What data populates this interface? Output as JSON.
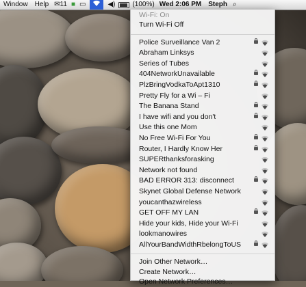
{
  "menubar": {
    "window_label": "Window",
    "help_label": "Help",
    "notif_count": "11",
    "battery_text": "(100%)",
    "clock": "Wed 2:06 PM",
    "user": "Steph"
  },
  "wifi_menu": {
    "status": "Wi-Fi: On",
    "toggle_label": "Turn Wi-Fi Off",
    "networks": [
      {
        "name": "Police Surveillance Van 2",
        "locked": true
      },
      {
        "name": "Abraham Linksys",
        "locked": false
      },
      {
        "name": "Series of Tubes",
        "locked": false
      },
      {
        "name": "404NetworkUnavailable",
        "locked": true
      },
      {
        "name": "PlzBringVodkaToApt1310",
        "locked": true
      },
      {
        "name": "Pretty Fly for a Wi – Fi",
        "locked": false
      },
      {
        "name": "The Banana Stand",
        "locked": true
      },
      {
        "name": "I have wifi and you don't",
        "locked": true
      },
      {
        "name": "Use this one Mom",
        "locked": false
      },
      {
        "name": "No Free Wi-Fi For You",
        "locked": true
      },
      {
        "name": "Router, I Hardly Know Her",
        "locked": true
      },
      {
        "name": "SUPERthanksforasking",
        "locked": false
      },
      {
        "name": "Network not found",
        "locked": false
      },
      {
        "name": "BAD ERROR 313: disconnect",
        "locked": true
      },
      {
        "name": "Skynet Global Defense Network",
        "locked": false
      },
      {
        "name": "youcanthazwireless",
        "locked": false
      },
      {
        "name": "GET OFF MY LAN",
        "locked": true
      },
      {
        "name": "Hide your kids, Hide your Wi-Fi",
        "locked": false
      },
      {
        "name": "lookmanowires",
        "locked": false
      },
      {
        "name": "AllYourBandWidthRbelongToUS",
        "locked": true
      }
    ],
    "actions": {
      "join_other": "Join Other Network…",
      "create": "Create Network…",
      "preferences": "Open Network Preferences…"
    }
  },
  "icons": {
    "menubar": [
      "notification-icon",
      "status-icon",
      "airplay-icon",
      "wifi-icon",
      "volume-icon",
      "battery-icon",
      "spotlight-icon"
    ],
    "menu": [
      "lock-icon",
      "wifi-signal-icon"
    ]
  },
  "colors": {
    "menu_highlight": "#2d5fd6",
    "menu_background": "#f6f6f6",
    "status_text": "#8a8a8a"
  }
}
